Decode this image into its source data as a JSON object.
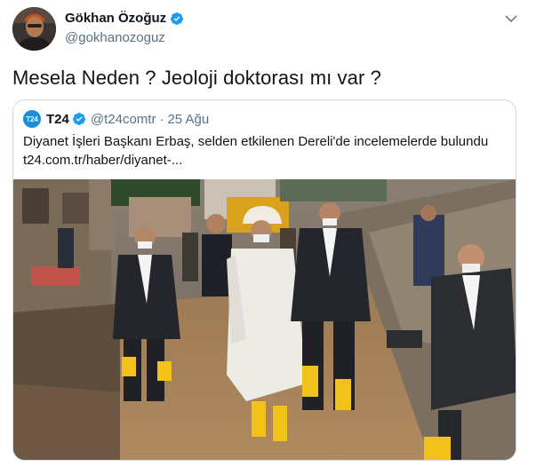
{
  "tweet": {
    "author": {
      "name": "Gökhan Özoğuz",
      "handle": "@gokhanozoguz",
      "verified_icon": "verified-badge-icon",
      "avatar": "avatar-photo"
    },
    "menu_icon": "chevron-down-icon",
    "text": "Mesela Neden ? Jeoloji doktorası mı var ?",
    "quoted": {
      "logo_text": "T24",
      "name": "T24",
      "handle": "@t24comtr",
      "separator": "·",
      "date": "25 Ağu",
      "body_line1": "Diyanet İşleri Başkanı Erbaş, selden etkilenen Dereli'de incelemelerde bulundu",
      "body_line2": "t24.com.tr/haber/diyanet-...",
      "photo": "flood-visit-photo"
    }
  },
  "colors": {
    "text": "#0f1419",
    "secondary": "#5b7083",
    "verified": "#1d9bf0",
    "border": "#cfd9de",
    "logo": "#1d8fd8"
  }
}
